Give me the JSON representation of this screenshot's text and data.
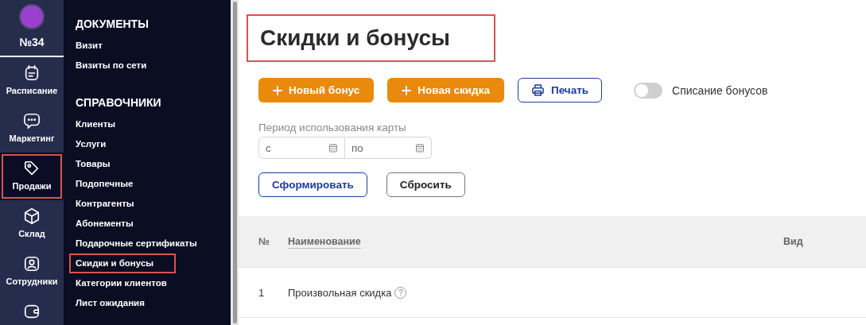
{
  "rail": {
    "badge": "№34",
    "items": [
      {
        "kind": "calendar",
        "label": "Расписание",
        "selected": false,
        "highlighted": false
      },
      {
        "kind": "chat",
        "label": "Маркетинг",
        "selected": false,
        "highlighted": false
      },
      {
        "kind": "tag",
        "label": "Продажи",
        "selected": true,
        "highlighted": true
      },
      {
        "kind": "box",
        "label": "Склад",
        "selected": false,
        "highlighted": false
      },
      {
        "kind": "person",
        "label": "Сотрудники",
        "selected": false,
        "highlighted": false
      },
      {
        "kind": "wallet",
        "selected": false,
        "highlighted": false
      }
    ]
  },
  "submenu": {
    "sections": [
      {
        "title": "ДОКУМЕНТЫ",
        "items": [
          {
            "label": "Визит",
            "highlighted": false
          },
          {
            "label": "Визиты по сети",
            "highlighted": false
          }
        ]
      },
      {
        "title": "СПРАВОЧНИКИ",
        "items": [
          {
            "label": "Клиенты",
            "highlighted": false
          },
          {
            "label": "Услуги",
            "highlighted": false
          },
          {
            "label": "Товары",
            "highlighted": false
          },
          {
            "label": "Подопечные",
            "highlighted": false
          },
          {
            "label": "Контрагенты",
            "highlighted": false
          },
          {
            "label": "Абонементы",
            "highlighted": false
          },
          {
            "label": "Подарочные сертификаты",
            "highlighted": false
          },
          {
            "label": "Скидки и бонусы",
            "highlighted": true
          },
          {
            "label": "Категории клиентов",
            "highlighted": false
          },
          {
            "label": "Лист ожидания",
            "highlighted": false
          }
        ]
      }
    ]
  },
  "page": {
    "title": "Скидки и бонусы",
    "title_highlighted": true,
    "buttons": [
      {
        "kind": "add",
        "label": "Новый бонус"
      },
      {
        "kind": "add",
        "label": "Новая скидка"
      },
      {
        "kind": "print",
        "label": "Печать"
      }
    ],
    "toggle": {
      "label": "Списание бонусов",
      "on": false
    },
    "period": {
      "label": "Период использования карты",
      "fields": [
        {
          "placeholder": "с"
        },
        {
          "placeholder": "по"
        }
      ]
    },
    "actions": [
      {
        "kind": "primary",
        "label": "Сформировать"
      },
      {
        "kind": "secondary",
        "label": "Сбросить"
      }
    ],
    "table": {
      "columns": [
        {
          "label": "№",
          "sortable": false
        },
        {
          "label": "Наименование",
          "sortable": true
        },
        {
          "label": "Вид",
          "sortable": false
        }
      ],
      "rows": [
        {
          "cells": [
            "1",
            "Произвольная скидка"
          ],
          "help": "?"
        }
      ]
    }
  }
}
